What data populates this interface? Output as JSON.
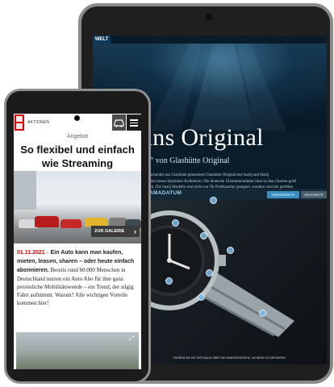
{
  "tablet": {
    "logo": "WELT",
    "hero_title": "chen ins Original",
    "hero_subtitle": "n „Spezialist“ von Glashütte Original",
    "body_lines": [
      "ren Taucheruhr aus Glashütte präsentiert Glashütte Original mit SeaQ und SeaQ",
      "ehnte drei neuen Spezialist-Kollektion. Die deutsche Uhrenmanufaktur lässt so den Charme groß",
      "aufleben. Die SeaQ Modelle sind nicht nur für Profitaucher geeignet, sondern sind der perfekte",
      "Herausforderungen des Alltags."
    ],
    "tab_label": "AMADATUM",
    "button_primary": "VORDERSEITE",
    "button_secondary": "RÜCKSEITE",
    "caption": "FAHREN SIE MIT DER MAUS ÜBER DIE MARKIERUNGEN, UM MEHR ZU ERFAHREN",
    "colors": {
      "accent": "#3d8fbf",
      "bezel": "#8a8a8a"
    }
  },
  "phone": {
    "header_nav": "AKTIONEN",
    "label": "Angebot",
    "headline": "So flexibel und einfach wie Streaming",
    "gallery_button": "ZUR GALERIE",
    "article_date": "01.11.2021",
    "article_lead": "Ein Auto kann man kaufen, mieten, leasen, sharen – oder heute einfach abonnieren.",
    "article_body": "Bereits rund 60.000 Menschen in Deutschland nutzen ein Auto Abo für ihre ganz persönliche Mobilitätswende – ein Trend, der zügig Fahrt aufnimmt. Warum? Alle wichtigen Vorteile kommen hier!",
    "colors": {
      "brand": "#d50000"
    }
  }
}
